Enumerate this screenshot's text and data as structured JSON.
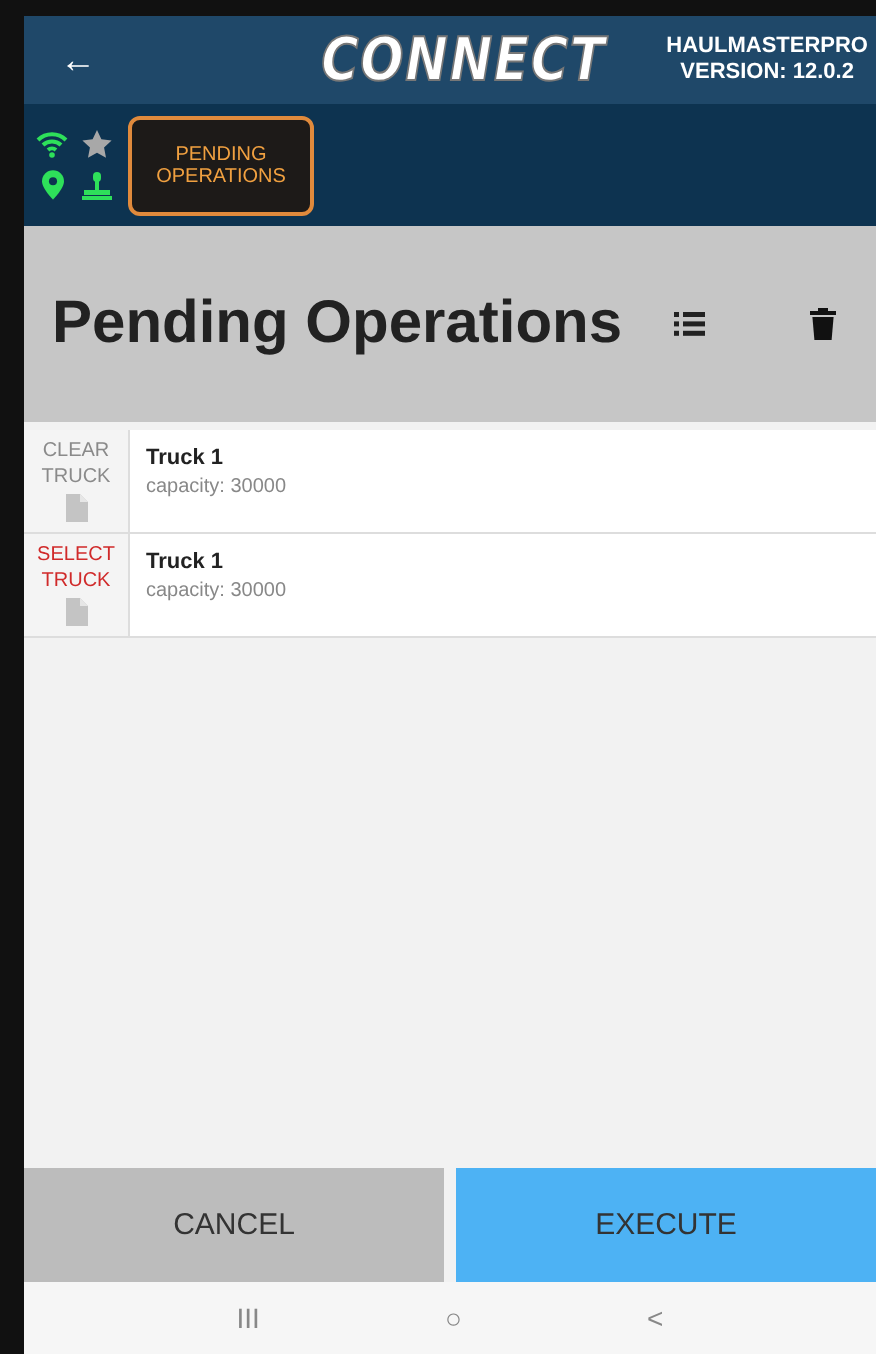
{
  "header": {
    "back": "←",
    "logo": "CONNECT",
    "app_name": "HAULMASTERPRO",
    "version": "VERSION: 12.0.2"
  },
  "toolbar": {
    "tabs": [
      {
        "label": "PENDING\nOPERATIONS",
        "selected": true
      }
    ]
  },
  "title_bar": {
    "title": "Pending Operations"
  },
  "trucks": [
    {
      "action": "CLEAR\nTRUCK",
      "kind": "clear",
      "name": "Truck 1",
      "capacity": "capacity: 30000"
    },
    {
      "action": "SELECT\nTRUCK",
      "kind": "select",
      "name": "Truck 1",
      "capacity": "capacity: 30000"
    }
  ],
  "buttons": [
    {
      "label": "CANCEL",
      "kind": "secondary"
    },
    {
      "label": "EXECUTE",
      "kind": "primary"
    }
  ],
  "nav_bar": {
    "recents": "III",
    "home": "○",
    "back": "<"
  }
}
